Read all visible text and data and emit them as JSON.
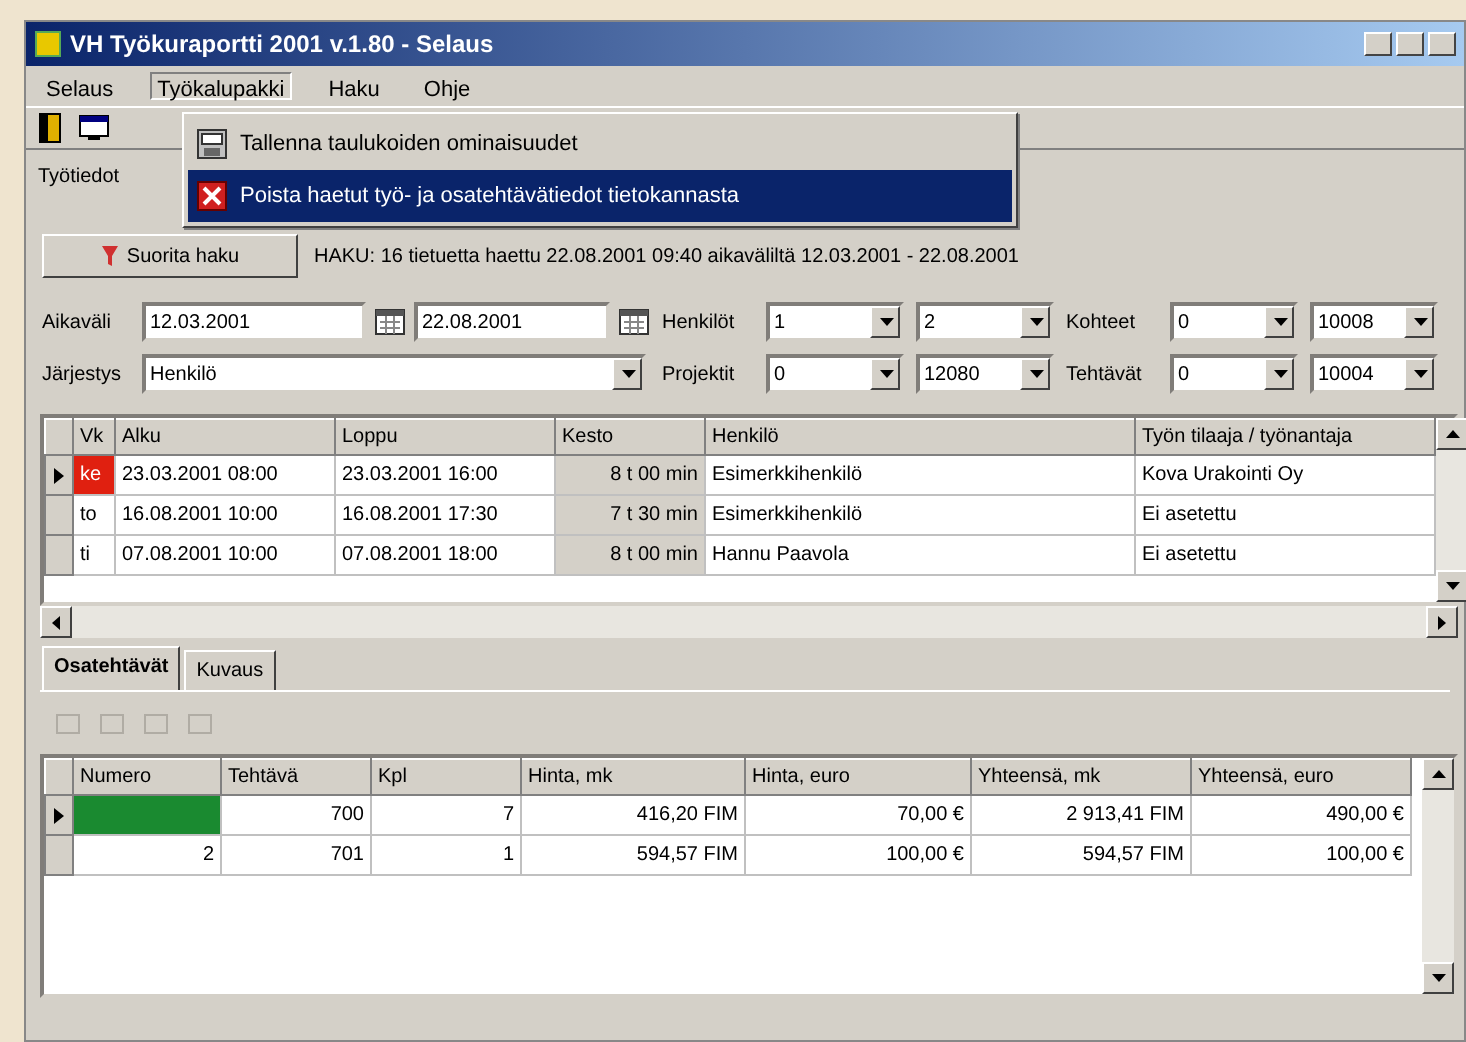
{
  "window": {
    "title": "VH Työkuraportti 2001 v.1.80 - Selaus"
  },
  "menu": [
    {
      "label": "Selaus",
      "open": false
    },
    {
      "label": "Työkalupakki",
      "open": true
    },
    {
      "label": "Haku",
      "open": false
    },
    {
      "label": "Ohje",
      "open": false
    }
  ],
  "dropdown": [
    {
      "label": "Tallenna taulukoiden ominaisuudet",
      "selected": false
    },
    {
      "label": "Poista haetut työ- ja osatehtävätiedot tietokannasta",
      "selected": true
    }
  ],
  "work_tab": {
    "label": "Työtiedot"
  },
  "search": {
    "button": "Suorita haku",
    "status": "HAKU: 16 tietuetta haettu 22.08.2001 09:40 aikaväliltä 12.03.2001 - 22.08.2001"
  },
  "filters": {
    "date_label": "Aikaväli",
    "date_from": "12.03.2001",
    "date_to": "22.08.2001",
    "order_label": "Järjestys",
    "order": "Henkilö",
    "ranges": [
      {
        "label": "Henkilöt",
        "from": "1",
        "to": "2"
      },
      {
        "label": "Projektit",
        "from": "0",
        "to": "12080"
      },
      {
        "label": "Kohteet",
        "from": "0",
        "to": "10008"
      },
      {
        "label": "Tehtävät",
        "from": "0",
        "to": "10004"
      }
    ]
  },
  "work_table": {
    "columns": [
      "Vk",
      "Alku",
      "Loppu",
      "Kesto",
      "Henkilö",
      "Työn tilaaja / työnantaja"
    ],
    "rows": [
      {
        "current": true,
        "cells": [
          "ke",
          "23.03.2001 08:00",
          "23.03.2001 16:00",
          "8 t 00 min",
          "Esimerkkihenkilö",
          "Kova Urakointi Oy"
        ]
      },
      {
        "current": false,
        "cells": [
          "to",
          "16.08.2001 10:00",
          "16.08.2001 17:30",
          "7 t 30 min",
          "Esimerkkihenkilö",
          "Ei asetettu"
        ]
      },
      {
        "current": false,
        "cells": [
          "ti",
          "07.08.2001 10:00",
          "07.08.2001 18:00",
          "8 t 00 min",
          "Hannu Paavola",
          "Ei asetettu"
        ]
      }
    ]
  },
  "tabs": [
    {
      "label": "Osatehtävät",
      "selected": true
    },
    {
      "label": "Kuvaus",
      "selected": false
    }
  ],
  "task_table": {
    "columns": [
      "Numero",
      "Tehtävä",
      "Kpl",
      "Hinta, mk",
      "Hinta, euro",
      "Yhteensä, mk",
      "Yhteensä, euro"
    ],
    "rows": [
      {
        "current": true,
        "cells": [
          "",
          "700",
          "7",
          "416,20 FIM",
          "70,00 €",
          "2 913,41 FIM",
          "490,00 €"
        ]
      },
      {
        "current": false,
        "cells": [
          "2",
          "701",
          "1",
          "594,57 FIM",
          "100,00 €",
          "594,57 FIM",
          "100,00 €"
        ]
      }
    ]
  }
}
